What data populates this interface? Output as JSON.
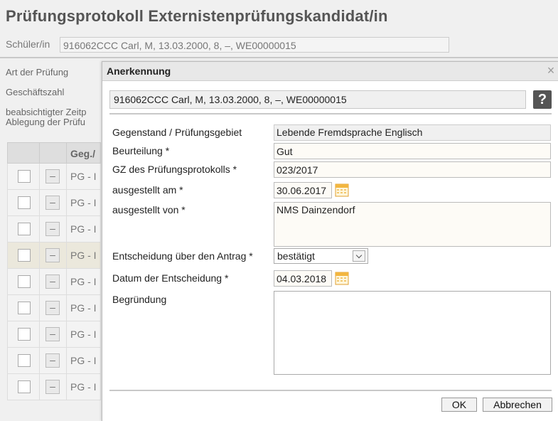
{
  "page": {
    "title": "Prüfungsprotokoll Externistenprüfungskandidat/in",
    "student_label": "Schüler/in",
    "student_value": "916062CCC Carl, M, 13.03.2000, 8, –, WE00000015",
    "labels": {
      "art": "Art der Prüfung",
      "gz": "Geschäftszahl",
      "zeit_line1": "beabsichtigter Zeitp",
      "zeit_line2": "Ablegung der Prüfu"
    },
    "table": {
      "header_col": "Geg./",
      "rows": [
        "PG - I",
        "PG - I",
        "PG - I",
        "PG - I",
        "PG - I",
        "PG - I",
        "PG - I",
        "PG - I",
        "PG - I"
      ],
      "minus": "–"
    }
  },
  "dialog": {
    "title": "Anerkennung",
    "close": "×",
    "student": "916062CCC Carl, M, 13.03.2000, 8, –, WE00000015",
    "help": "?",
    "fields": {
      "gegenstand_label": "Gegenstand / Prüfungsgebiet",
      "gegenstand_value": "Lebende Fremdsprache Englisch",
      "beurteilung_label": "Beurteilung *",
      "beurteilung_value": "Gut",
      "gz_label": "GZ des Prüfungsprotokolls *",
      "gz_value": "023/2017",
      "ausgestellt_am_label": "ausgestellt am *",
      "ausgestellt_am_value": "30.06.2017",
      "ausgestellt_von_label": "ausgestellt von *",
      "ausgestellt_von_value": "NMS Dainzendorf",
      "entscheidung_label": "Entscheidung über den Antrag *",
      "entscheidung_value": "bestätigt",
      "datum_label": "Datum der Entscheidung *",
      "datum_value": "04.03.2018",
      "begruendung_label": "Begründung",
      "begruendung_value": ""
    },
    "buttons": {
      "ok": "OK",
      "cancel": "Abbrechen"
    }
  },
  "colors": {
    "calendar_icon": "#f2b640",
    "help_button": "#555555"
  }
}
